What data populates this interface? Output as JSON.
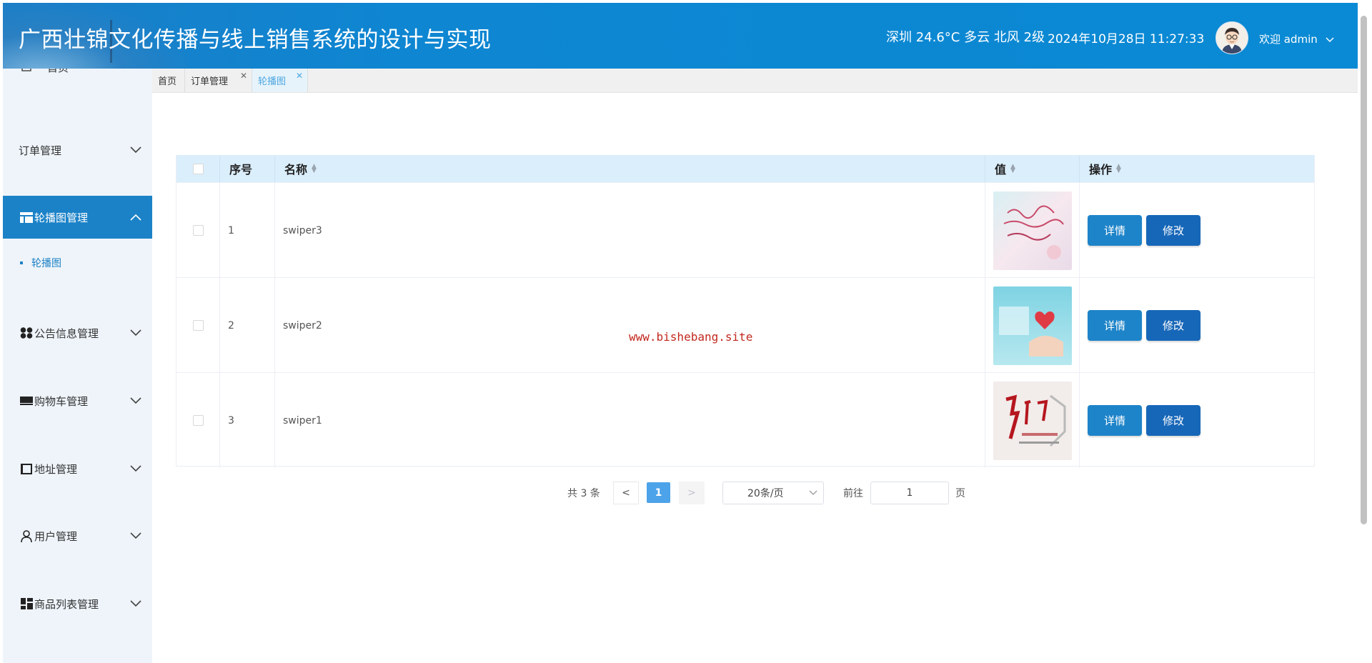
{
  "header": {
    "title": "广西壮锦文化传播与线上销售系统的设计与实现",
    "weather": "深圳 24.6°C 多云 北风 2级",
    "datetime": "2024年10月28日 11:27:33",
    "welcome": "欢迎 admin"
  },
  "sidebar": {
    "top_item": "首页",
    "items": [
      {
        "label": "订单管理",
        "icon": "none"
      },
      {
        "label": "轮播图管理",
        "icon": "table-icon",
        "active": true
      },
      {
        "label": "公告信息管理",
        "icon": "four-dots-icon"
      },
      {
        "label": "购物车管理",
        "icon": "keyboard-icon"
      },
      {
        "label": "地址管理",
        "icon": "book-icon"
      },
      {
        "label": "用户管理",
        "icon": "user-icon"
      },
      {
        "label": "商品列表管理",
        "icon": "grid-icon"
      }
    ],
    "subitem": "轮播图"
  },
  "tabs": [
    {
      "label": "首页"
    },
    {
      "label": "订单管理"
    },
    {
      "label": "轮播图",
      "active": true
    }
  ],
  "table": {
    "columns": [
      "序号",
      "名称",
      "值",
      "操作"
    ],
    "rows": [
      {
        "index": "1",
        "name": "swiper3",
        "image": "swiper3"
      },
      {
        "index": "2",
        "name": "swiper2",
        "image": "swiper2"
      },
      {
        "index": "3",
        "name": "swiper1",
        "image": "swiper1"
      }
    ],
    "detail_label": "详情",
    "edit_label": "修改"
  },
  "watermark": "www.bishebang.site",
  "pagination": {
    "total": "共 3 条",
    "prev": "<",
    "current_page": "1",
    "next": ">",
    "page_size": "20条/页",
    "goto_label": "前往",
    "goto_value": "1",
    "page_unit": "页"
  },
  "colors": {
    "header_bg": "#0e86d2",
    "sidebar_bg": "#eef4fa",
    "active_menu": "#1b82c8",
    "table_header_bg": "#dbeefc",
    "detail_button": "#1e84c9",
    "edit_button": "#1767b8",
    "watermark": "#c2281e"
  }
}
